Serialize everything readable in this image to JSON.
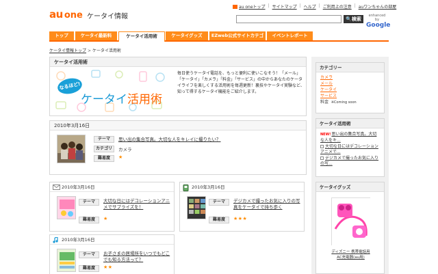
{
  "header": {
    "logo_au": "au",
    "logo_one": "one",
    "logo_sub": "ケータイ情報",
    "top_links": [
      "au oneトップ",
      "サイトマップ",
      "ヘルプ",
      "ご利用上の注意",
      "auワンちゃんの部屋"
    ],
    "search_placeholder": "",
    "search_button": "検索",
    "google_line1": "enhanced by",
    "google_line2": "Google"
  },
  "nav": {
    "tabs": [
      "トップ",
      "ケータイ最新料",
      "ケータイ活用術",
      "ケータイグッズ",
      "EZweb公式サイトカテゴリ",
      "イベントレポート"
    ],
    "active_index": 2
  },
  "breadcrumb": {
    "parent": "ケータイ情報トップ",
    "separator": ">",
    "current": "ケータイ活用術"
  },
  "hero": {
    "box_title": "ケータイ活用術",
    "badge": "なるほど!",
    "title_part1": "ケータイ",
    "title_part2": "活用術",
    "description": "毎日使うケータイ電話を、もっと便利に使いこなそう！「メール」「ケータイ」「カメラ」「料金」「サービス」の中からあなたのケータイライフを楽しくする活用術を毎週更新！裏技やケータイ実験など、知って得するケータイ機能をご紹介します。"
  },
  "labels": {
    "theme": "テーマ",
    "category": "カテゴリ",
    "difficulty": "難易度"
  },
  "feature": {
    "date": "2010年3月16日",
    "theme": "思い出の集合写真。大切な人をキレイに撮りたい？",
    "category": "カメラ",
    "stars": "★"
  },
  "cards": [
    {
      "date": "2010年3月16日",
      "icon": "mail-icon",
      "theme": "大切な日にはデコレーションアニメでサプライズを！",
      "stars": "★"
    },
    {
      "date": "2010年3月16日",
      "icon": "phone-icon",
      "theme": "デジカメで撮ったお気に入りの写真をケータイで持ち歩く",
      "stars": "★★★"
    },
    {
      "date": "2010年3月16日",
      "icon": "music-note-icon",
      "theme": "お子さまの居場所をいつでもどこでも知る方法って？",
      "stars": "★★"
    }
  ],
  "sidebar": {
    "category_title": "カテゴリー",
    "categories": [
      "カメラ",
      "メール",
      "ケータイ",
      "サービス"
    ],
    "category_soon_label": "料金",
    "category_soon_note": "※Coming soon",
    "howto_title": "ケータイ活用術",
    "howto_items": [
      {
        "new": "NEW!",
        "text": "思い出の集合写真。大切な人をキ..."
      },
      {
        "new": "",
        "text": "大切な日にはデコレーションアニメで..."
      },
      {
        "new": "",
        "text": "デジカメで撮ったお気に入りの写..."
      }
    ],
    "goods_title": "ケータイグッズ",
    "goods_caption_line1": "ディズニー 携帯電話用",
    "goods_caption_line2": "AC充電器(au用)"
  },
  "colors": {
    "brand_orange": "#ff6600",
    "tab_orange": "#ff8c1a",
    "hero_blue": "#1a9ad6",
    "star": "#ff8c00"
  }
}
